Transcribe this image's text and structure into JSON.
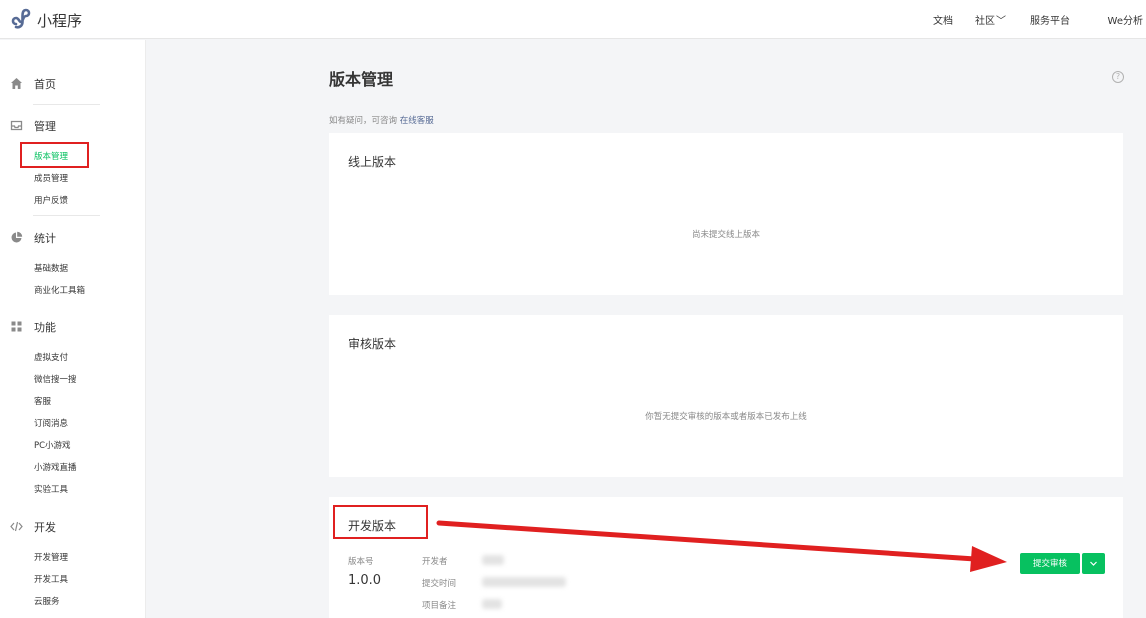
{
  "header": {
    "app_name": "小程序",
    "nav": [
      "文档",
      "社区",
      "服务平台",
      "We分析"
    ]
  },
  "sidebar": {
    "home": "首页",
    "manage": {
      "label": "管理",
      "items": [
        "版本管理",
        "成员管理",
        "用户反馈"
      ]
    },
    "stats": {
      "label": "统计",
      "items": [
        "基础数据",
        "商业化工具箱"
      ]
    },
    "features": {
      "label": "功能",
      "items": [
        "虚拟支付",
        "微信搜一搜",
        "客服",
        "订阅消息",
        "PC小游戏",
        "小游戏直播",
        "实验工具"
      ]
    },
    "dev": {
      "label": "开发",
      "items": [
        "开发管理",
        "开发工具",
        "云服务"
      ]
    }
  },
  "main": {
    "title": "版本管理",
    "help": "?",
    "tip_prefix": "如有疑问，可咨询",
    "tip_link": "在线客服",
    "online": {
      "title": "线上版本",
      "empty": "尚未提交线上版本"
    },
    "review": {
      "title": "审核版本",
      "empty": "你暂无提交审核的版本或者版本已发布上线"
    },
    "develop": {
      "title": "开发版本",
      "version_label": "版本号",
      "version": "1.0.0",
      "developer_label": "开发者",
      "submit_time_label": "提交时间",
      "remark_label": "项目备注",
      "submit_button": "提交审核"
    }
  },
  "colors": {
    "accent": "#07c160",
    "highlight": "#e02020",
    "link": "#576b95"
  }
}
